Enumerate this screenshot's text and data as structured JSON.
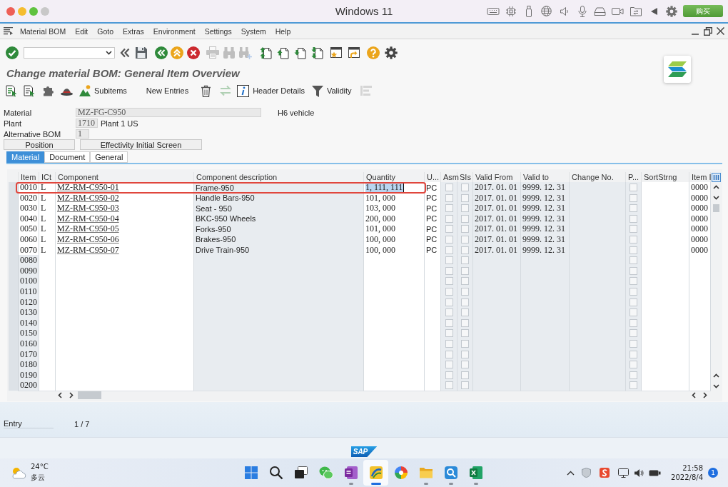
{
  "mac_window": {
    "title": "Windows 11",
    "buy_button": "购买"
  },
  "menu": [
    "Material BOM",
    "Edit",
    "Goto",
    "Extras",
    "Environment",
    "Settings",
    "System",
    "Help"
  ],
  "toolbar": [
    {
      "kind": "enter",
      "disabled": false
    },
    {
      "kind": "command",
      "disabled": false
    },
    {
      "kind": "collapse",
      "disabled": false
    },
    {
      "kind": "save",
      "disabled": false
    },
    {
      "kind": "back",
      "disabled": false
    },
    {
      "kind": "exit",
      "disabled": false
    },
    {
      "kind": "cancel",
      "disabled": false
    },
    {
      "kind": "print",
      "disabled": true
    },
    {
      "kind": "find",
      "disabled": true
    },
    {
      "kind": "findnext",
      "disabled": true
    },
    {
      "kind": "first",
      "disabled": false
    },
    {
      "kind": "previous",
      "disabled": false
    },
    {
      "kind": "next",
      "disabled": false
    },
    {
      "kind": "last",
      "disabled": false
    },
    {
      "kind": "session",
      "disabled": false
    },
    {
      "kind": "shortcut",
      "disabled": false
    },
    {
      "kind": "help",
      "disabled": false
    },
    {
      "kind": "settings",
      "disabled": false
    }
  ],
  "title": "Change material BOM: General Item Overview",
  "app_toolbar": [
    {
      "kind": "select",
      "disabled": false
    },
    {
      "kind": "deselect",
      "disabled": false
    },
    {
      "kind": "puzzle",
      "disabled": false
    },
    {
      "kind": "hat",
      "disabled": false
    },
    {
      "kind": "subitems",
      "label": "Subitems",
      "disabled": false
    },
    {
      "kind": "entries",
      "label": "New Entries",
      "disabled": false
    },
    {
      "kind": "delete",
      "disabled": false
    },
    {
      "kind": "swap",
      "disabled": true
    },
    {
      "kind": "details",
      "label": "Header Details",
      "disabled": false
    },
    {
      "kind": "filter",
      "label": "Validity",
      "disabled": false
    },
    {
      "kind": "outline",
      "disabled": true
    }
  ],
  "header": {
    "fields": [
      {
        "label": "Material",
        "value": "MZ-FG-C950",
        "description": "H6 vehicle"
      },
      {
        "label": "Plant",
        "value": "1710",
        "description": "Plant 1 US"
      },
      {
        "label": "Alternative BOM",
        "value": "1"
      }
    ],
    "buttons": [
      "Position",
      "Effectivity Initial Screen"
    ]
  },
  "tabs": [
    {
      "label": "Material",
      "selected": true
    },
    {
      "label": "Document",
      "selected": false
    },
    {
      "label": "General",
      "selected": false
    }
  ],
  "table": {
    "columns": [
      "Item",
      "ICt",
      "Component",
      "Component description",
      "Quantity",
      "U...",
      "Asm",
      "SIs",
      "Valid From",
      "Valid to",
      "Change No.",
      "P...",
      "SortStrng",
      "Item I"
    ],
    "rows": [
      {
        "item": "0010",
        "ict": "L",
        "component": "MZ-RM-C950-01",
        "description": "Frame-950",
        "quantity": "1, 111, 111",
        "unit": "PC",
        "asm_checked": false,
        "sis_checked": false,
        "valid_from": "2017. 01. 01",
        "valid_to": "9999. 12. 31",
        "p_checked": false,
        "item_id": "0000",
        "highlighted": true,
        "quantity_selected": true
      },
      {
        "item": "0020",
        "ict": "L",
        "component": "MZ-RM-C950-02",
        "description": "Handle Bars-950",
        "quantity": "101, 000",
        "unit": "PC",
        "asm_checked": false,
        "sis_checked": false,
        "valid_from": "2017. 01. 01",
        "valid_to": "9999. 12. 31",
        "p_checked": false,
        "item_id": "0000",
        "highlighted": false,
        "quantity_selected": false
      },
      {
        "item": "0030",
        "ict": "L",
        "component": "MZ-RM-C950-03",
        "description": "Seat - 950",
        "quantity": "103, 000",
        "unit": "PC",
        "asm_checked": false,
        "sis_checked": false,
        "valid_from": "2017. 01. 01",
        "valid_to": "9999. 12. 31",
        "p_checked": false,
        "item_id": "0000",
        "highlighted": false,
        "quantity_selected": false
      },
      {
        "item": "0040",
        "ict": "L",
        "component": "MZ-RM-C950-04",
        "description": "BKC-950 Wheels",
        "quantity": "200, 000",
        "unit": "PC",
        "asm_checked": false,
        "sis_checked": false,
        "valid_from": "2017. 01. 01",
        "valid_to": "9999. 12. 31",
        "p_checked": false,
        "item_id": "0000",
        "highlighted": false,
        "quantity_selected": false
      },
      {
        "item": "0050",
        "ict": "L",
        "component": "MZ-RM-C950-05",
        "description": "Forks-950",
        "quantity": "101, 000",
        "unit": "PC",
        "asm_checked": false,
        "sis_checked": false,
        "valid_from": "2017. 01. 01",
        "valid_to": "9999. 12. 31",
        "p_checked": false,
        "item_id": "0000",
        "highlighted": false,
        "quantity_selected": false
      },
      {
        "item": "0060",
        "ict": "L",
        "component": "MZ-RM-C950-06",
        "description": "Brakes-950",
        "quantity": "100, 000",
        "unit": "PC",
        "asm_checked": false,
        "sis_checked": false,
        "valid_from": "2017. 01. 01",
        "valid_to": "9999. 12. 31",
        "p_checked": false,
        "item_id": "0000",
        "highlighted": false,
        "quantity_selected": false
      },
      {
        "item": "0070",
        "ict": "L",
        "component": "MZ-RM-C950-07",
        "description": "Drive Train-950",
        "quantity": "100, 000",
        "unit": "PC",
        "asm_checked": false,
        "sis_checked": false,
        "valid_from": "2017. 01. 01",
        "valid_to": "9999. 12. 31",
        "p_checked": false,
        "item_id": "0000",
        "highlighted": false,
        "quantity_selected": false
      },
      {
        "item": "0080",
        "asm_checked": false,
        "sis_checked": false,
        "p_checked": false,
        "highlighted": false,
        "quantity_selected": false
      },
      {
        "item": "0090",
        "asm_checked": false,
        "sis_checked": false,
        "p_checked": false,
        "highlighted": false,
        "quantity_selected": false
      },
      {
        "item": "0100",
        "asm_checked": false,
        "sis_checked": false,
        "p_checked": false,
        "highlighted": false,
        "quantity_selected": false
      },
      {
        "item": "0110",
        "asm_checked": false,
        "sis_checked": false,
        "p_checked": false,
        "highlighted": false,
        "quantity_selected": false
      },
      {
        "item": "0120",
        "asm_checked": false,
        "sis_checked": false,
        "p_checked": false,
        "highlighted": false,
        "quantity_selected": false
      },
      {
        "item": "0130",
        "asm_checked": false,
        "sis_checked": false,
        "p_checked": false,
        "highlighted": false,
        "quantity_selected": false
      },
      {
        "item": "0140",
        "asm_checked": false,
        "sis_checked": false,
        "p_checked": false,
        "highlighted": false,
        "quantity_selected": false
      },
      {
        "item": "0150",
        "asm_checked": false,
        "sis_checked": false,
        "p_checked": false,
        "highlighted": false,
        "quantity_selected": false
      },
      {
        "item": "0160",
        "asm_checked": false,
        "sis_checked": false,
        "p_checked": false,
        "highlighted": false,
        "quantity_selected": false
      },
      {
        "item": "0170",
        "asm_checked": false,
        "sis_checked": false,
        "p_checked": false,
        "highlighted": false,
        "quantity_selected": false
      },
      {
        "item": "0180",
        "asm_checked": false,
        "sis_checked": false,
        "p_checked": false,
        "highlighted": false,
        "quantity_selected": false
      },
      {
        "item": "0190",
        "asm_checked": false,
        "sis_checked": false,
        "p_checked": false,
        "highlighted": false,
        "quantity_selected": false
      },
      {
        "item": "0200",
        "asm_checked": false,
        "sis_checked": false,
        "p_checked": false,
        "highlighted": false,
        "quantity_selected": false
      }
    ]
  },
  "status": {
    "label": "Entry",
    "position": "1 / 7"
  },
  "footer": {
    "logo": "SAP"
  },
  "taskbar": {
    "weather": {
      "temperature": "24°C",
      "condition": "多云"
    },
    "apps": [
      {
        "kind": "start",
        "running": false,
        "selected": false
      },
      {
        "kind": "search",
        "running": false,
        "selected": false
      },
      {
        "kind": "taskview",
        "running": false,
        "selected": false
      },
      {
        "kind": "chat",
        "running": false,
        "selected": false
      },
      {
        "kind": "notebook",
        "running": true,
        "selected": false
      },
      {
        "kind": "gui",
        "running": true,
        "selected": true
      },
      {
        "kind": "palette",
        "running": false,
        "selected": false
      },
      {
        "kind": "folder",
        "running": true,
        "selected": false
      },
      {
        "kind": "magnifier",
        "running": true,
        "selected": false
      },
      {
        "kind": "sheet",
        "running": true,
        "selected": false
      }
    ],
    "clock": {
      "time": "21:58",
      "date": "2022/8/4"
    },
    "notifications": "1"
  }
}
